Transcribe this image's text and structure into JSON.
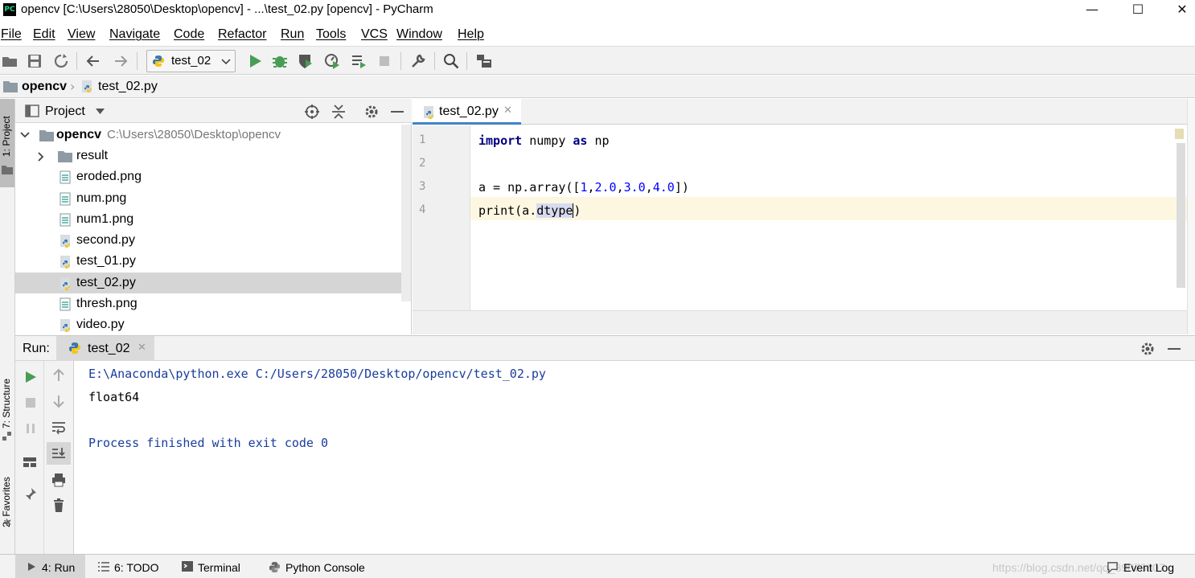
{
  "window": {
    "app_icon": "PC",
    "title": "opencv [C:\\Users\\28050\\Desktop\\opencv] - ...\\test_02.py [opencv] - PyCharm",
    "controls": [
      "minimize-icon",
      "maximize-icon",
      "close-icon"
    ]
  },
  "menu": [
    "File",
    "Edit",
    "View",
    "Navigate",
    "Code",
    "Refactor",
    "Run",
    "Tools",
    "VCS",
    "Window",
    "Help"
  ],
  "toolbar": {
    "run_config": "test_02",
    "icons": [
      "open-folder-icon",
      "save-icon",
      "sync-icon",
      "back-arrow-icon",
      "forward-arrow-icon",
      "run-icon",
      "debug-icon",
      "coverage-icon",
      "profile-icon",
      "concurrency-icon",
      "stop-icon",
      "wrench-icon",
      "search-icon",
      "project-structure-icon"
    ]
  },
  "breadcrumb": {
    "project": "opencv",
    "file": "test_02.py"
  },
  "left_stripe": {
    "project_tab": "1: Project",
    "structure_tab": "7: Structure",
    "favorites_tab": "2: Favorites"
  },
  "project_panel": {
    "title": "Project",
    "root_name": "opencv",
    "root_path": "C:\\Users\\28050\\Desktop\\opencv",
    "items": [
      {
        "name": "result",
        "kind": "folder"
      },
      {
        "name": "eroded.png",
        "kind": "image"
      },
      {
        "name": "num.png",
        "kind": "image"
      },
      {
        "name": "num1.png",
        "kind": "image"
      },
      {
        "name": "second.py",
        "kind": "python"
      },
      {
        "name": "test_01.py",
        "kind": "python"
      },
      {
        "name": "test_02.py",
        "kind": "python",
        "selected": true
      },
      {
        "name": "thresh.png",
        "kind": "image"
      },
      {
        "name": "video.py",
        "kind": "python"
      }
    ]
  },
  "editor": {
    "tab": "test_02.py",
    "line_numbers": [
      "1",
      "2",
      "3",
      "4"
    ],
    "code": {
      "l1_import": "import",
      "l1_mod": " numpy ",
      "l1_as": "as",
      "l1_alias": " np",
      "l3_pre": "a = np.array([",
      "l3_n1": "1",
      "l3_c1": ",",
      "l3_n2": "2.0",
      "l3_c2": ",",
      "l3_n3": "3.0",
      "l3_c3": ",",
      "l3_n4": "4.0",
      "l3_post": "])",
      "l4_pre": "print(a.",
      "l4_attr": "dtype",
      "l4_post": ")"
    }
  },
  "run_panel": {
    "label": "Run:",
    "tab": "test_02",
    "console": [
      "E:\\Anaconda\\python.exe C:/Users/28050/Desktop/opencv/test_02.py",
      "float64",
      "",
      "Process finished with exit code 0"
    ]
  },
  "bottom_bar": {
    "run": "4: Run",
    "todo": "6: TODO",
    "terminal": "Terminal",
    "python_console": "Python Console",
    "event_log": "Event Log",
    "watermark": "https://blog.csdn.net/qq_39073607"
  },
  "colors": {
    "keyword": "#000080",
    "number": "#0000ff",
    "console_blue": "#1a3d9c",
    "run_green": "#499c54",
    "current_line": "#fdf7e2"
  }
}
